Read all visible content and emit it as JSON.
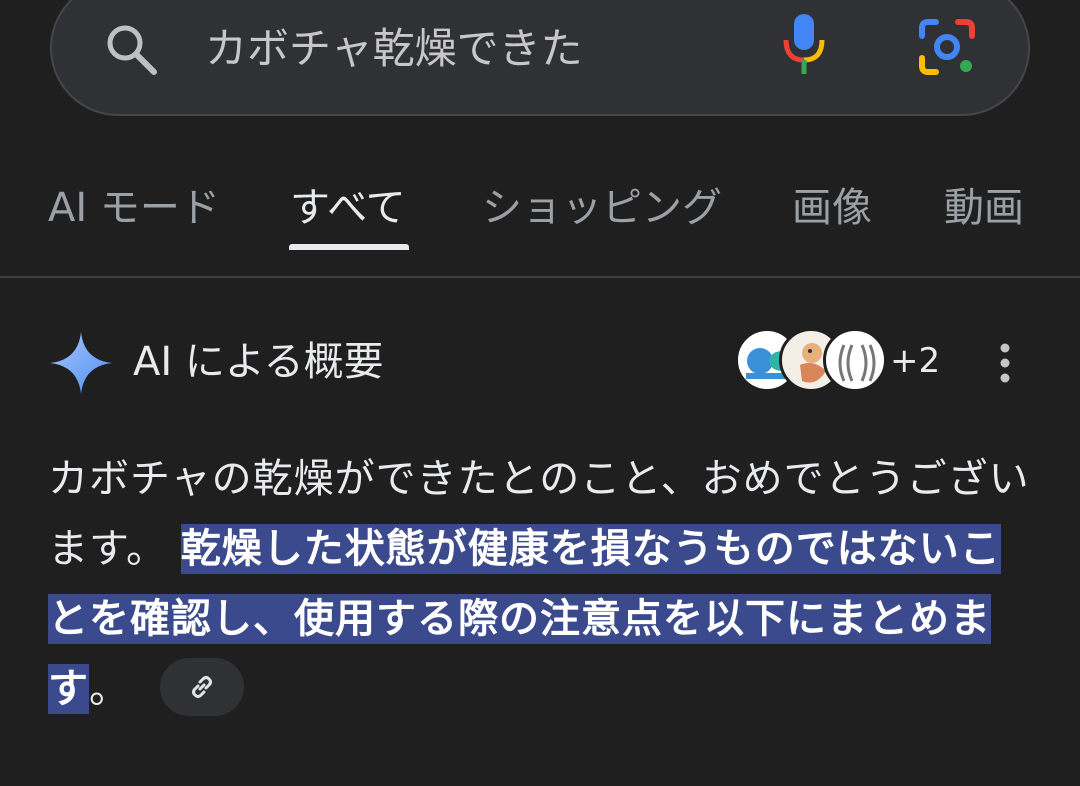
{
  "search": {
    "query": "カボチャ乾燥できた"
  },
  "tabs": [
    {
      "label": "AI モード",
      "active": false
    },
    {
      "label": "すべて",
      "active": true
    },
    {
      "label": "ショッピング",
      "active": false
    },
    {
      "label": "画像",
      "active": false
    },
    {
      "label": "動画",
      "active": false
    }
  ],
  "ai_overview": {
    "title": "AI による概要",
    "source_count": "+2",
    "text_plain": "カボチャの乾燥ができたとのこと、おめでとうございます。",
    "text_highlight": "乾燥した状態が健康を損なうものではないことを確認し、使用する際の注意点を以下にまとめます",
    "text_end": "。"
  },
  "icons": {
    "search": "search-icon",
    "mic": "mic-icon",
    "lens": "lens-icon",
    "sparkle": "sparkle-icon",
    "more": "more-vert-icon",
    "link": "link-icon"
  },
  "colors": {
    "background": "#1f1f1f",
    "search_bg": "#303134",
    "highlight": "#3b4a8c",
    "sparkle": "#8ab4f8"
  }
}
